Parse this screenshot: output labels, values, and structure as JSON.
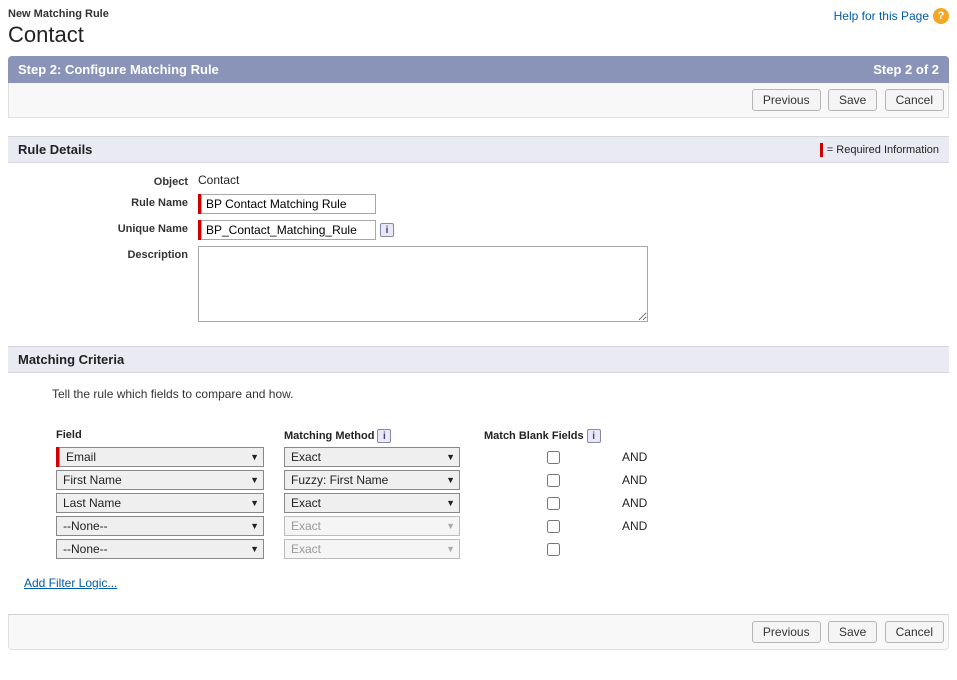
{
  "header": {
    "subtitle": "New Matching Rule",
    "title": "Contact",
    "help_label": "Help for this Page",
    "help_icon_glyph": "?"
  },
  "step_bar": {
    "left": "Step 2: Configure Matching Rule",
    "right": "Step 2 of 2"
  },
  "buttons": {
    "previous": "Previous",
    "save": "Save",
    "cancel": "Cancel"
  },
  "rule_details": {
    "section_title": "Rule Details",
    "required_legend": "= Required Information",
    "labels": {
      "object": "Object",
      "rule_name": "Rule Name",
      "unique_name": "Unique Name",
      "description": "Description"
    },
    "values": {
      "object": "Contact",
      "rule_name": "BP Contact Matching Rule",
      "unique_name": "BP_Contact_Matching_Rule",
      "description": ""
    },
    "info_glyph": "i"
  },
  "matching_criteria": {
    "section_title": "Matching Criteria",
    "intro_text": "Tell the rule which fields to compare and how.",
    "columns": {
      "field": "Field",
      "method": "Matching Method",
      "blank": "Match Blank Fields"
    },
    "info_glyph": "i",
    "logic_and": "AND",
    "rows": [
      {
        "field": "Email",
        "method": "Exact",
        "method_disabled": false,
        "required": true,
        "blank_checked": false,
        "show_logic": true
      },
      {
        "field": "First Name",
        "method": "Fuzzy: First Name",
        "method_disabled": false,
        "required": false,
        "blank_checked": false,
        "show_logic": true
      },
      {
        "field": "Last Name",
        "method": "Exact",
        "method_disabled": false,
        "required": false,
        "blank_checked": false,
        "show_logic": true
      },
      {
        "field": "--None--",
        "method": "Exact",
        "method_disabled": true,
        "required": false,
        "blank_checked": false,
        "show_logic": true
      },
      {
        "field": "--None--",
        "method": "Exact",
        "method_disabled": true,
        "required": false,
        "blank_checked": false,
        "show_logic": false
      }
    ],
    "add_filter_logic": "Add Filter Logic..."
  }
}
